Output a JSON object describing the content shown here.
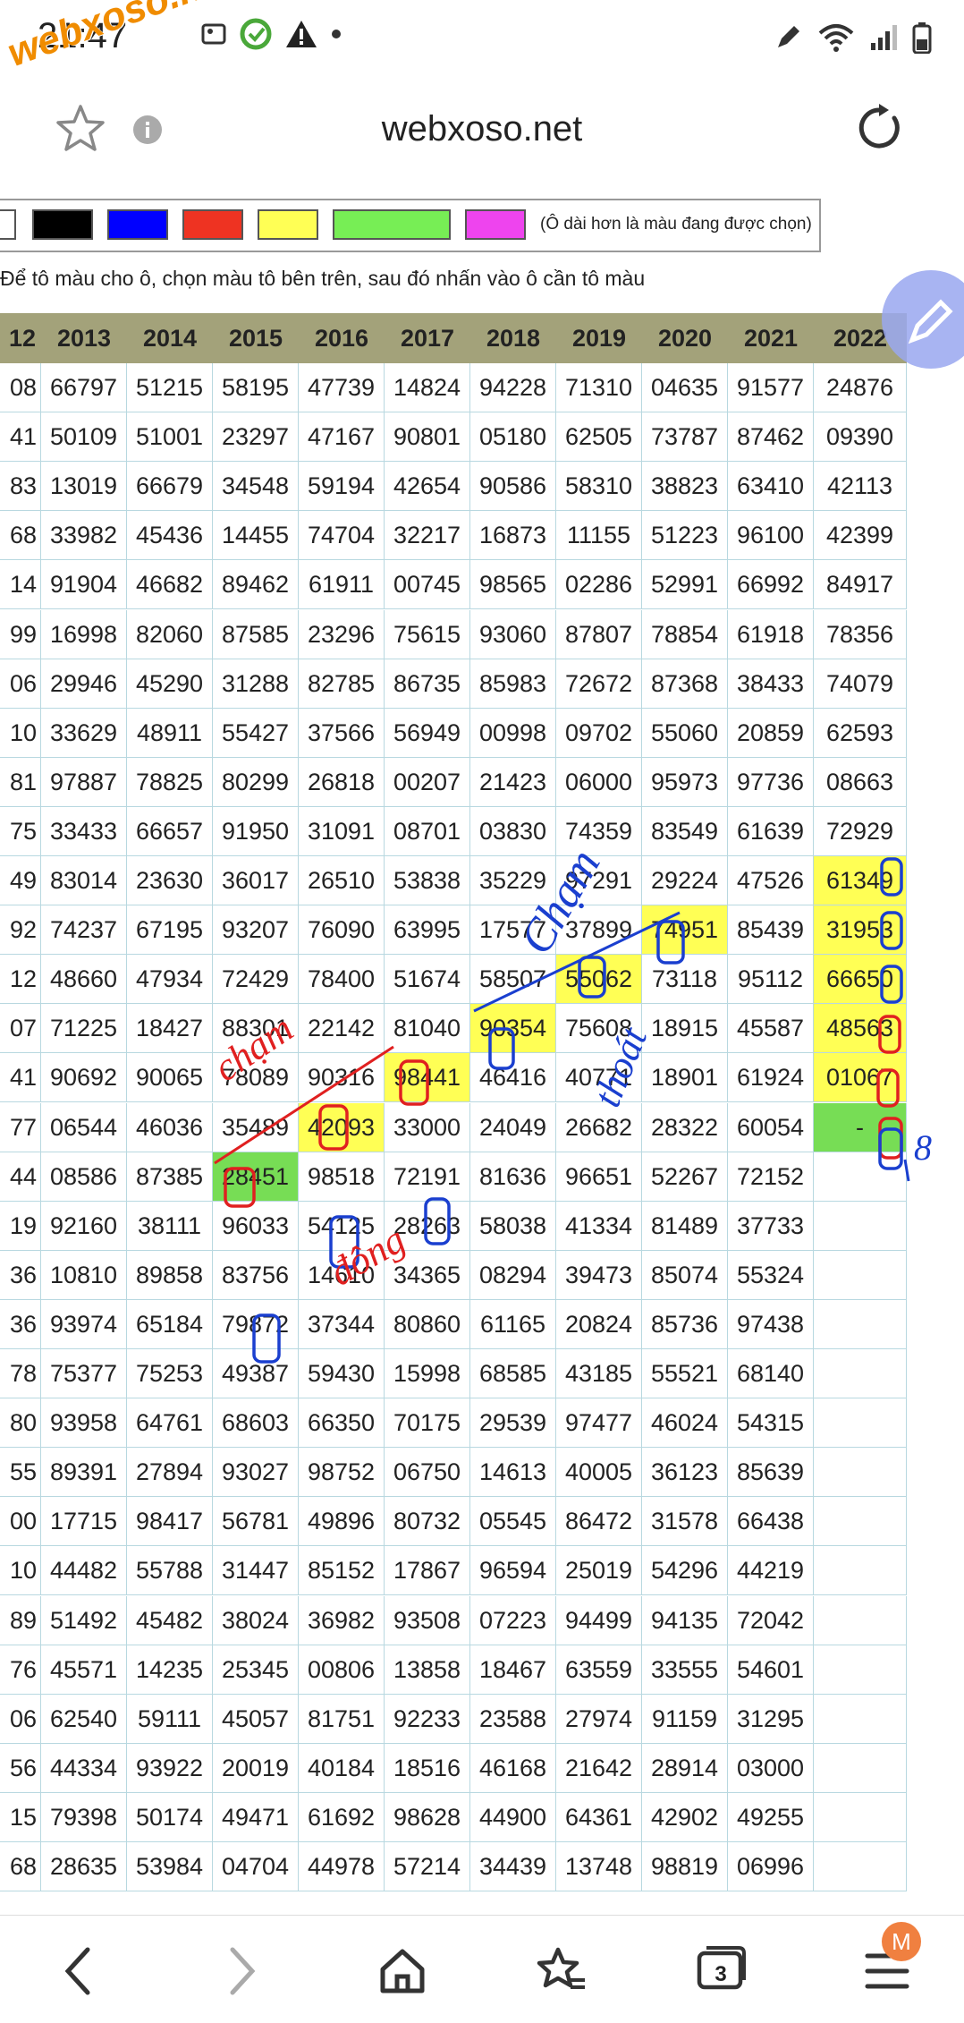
{
  "status": {
    "time": "21:47",
    "watermark": "webxoso.net"
  },
  "browser": {
    "title": "webxoso.net",
    "tab_count": "3",
    "profile_initial": "M"
  },
  "palette": {
    "colors": [
      "#ffffff",
      "#000000",
      "#0000ff",
      "#ee3322",
      "#ffff55",
      "#77ee55",
      "#ee44ee"
    ],
    "note": "(Ô dài hơn là màu đang được chọn)"
  },
  "instruction": "Để tô màu cho ô, chọn màu tô bên trên, sau đó nhấn vào ô cần tô màu",
  "table": {
    "headers": [
      "12",
      "2013",
      "2014",
      "2015",
      "2016",
      "2017",
      "2018",
      "2019",
      "2020",
      "2021",
      "2022"
    ],
    "rows": [
      [
        "08",
        "66797",
        "51215",
        "58195",
        "47739",
        "14824",
        "94228",
        "71310",
        "04635",
        "91577",
        "24876"
      ],
      [
        "41",
        "50109",
        "51001",
        "23297",
        "47167",
        "90801",
        "05180",
        "62505",
        "73787",
        "87462",
        "09390"
      ],
      [
        "83",
        "13019",
        "66679",
        "34548",
        "59194",
        "42654",
        "90586",
        "58310",
        "38823",
        "63410",
        "42113"
      ],
      [
        "68",
        "33982",
        "45436",
        "14455",
        "74704",
        "32217",
        "16873",
        "11155",
        "51223",
        "96100",
        "42399"
      ],
      [
        "14",
        "91904",
        "46682",
        "89462",
        "61911",
        "00745",
        "98565",
        "02286",
        "52991",
        "66992",
        "84917"
      ],
      [
        "99",
        "16998",
        "82060",
        "87585",
        "23296",
        "75615",
        "93060",
        "87807",
        "78854",
        "61918",
        "78356"
      ],
      [
        "06",
        "29946",
        "45290",
        "31288",
        "82785",
        "86735",
        "85983",
        "72672",
        "87368",
        "38433",
        "74079"
      ],
      [
        "10",
        "33629",
        "48911",
        "55427",
        "37566",
        "56949",
        "00998",
        "09702",
        "55060",
        "20859",
        "62593"
      ],
      [
        "81",
        "97887",
        "78825",
        "80299",
        "26818",
        "00207",
        "21423",
        "06000",
        "95973",
        "97736",
        "08663"
      ],
      [
        "75",
        "33433",
        "66657",
        "91950",
        "31091",
        "08701",
        "03830",
        "74359",
        "83549",
        "61639",
        "72929"
      ],
      [
        "49",
        "83014",
        "23630",
        "36017",
        "26510",
        "53838",
        "35229",
        "97291",
        "29224",
        "47526",
        "61349"
      ],
      [
        "92",
        "74237",
        "67195",
        "93207",
        "76090",
        "63995",
        "17577",
        "37899",
        "74951",
        "85439",
        "31953"
      ],
      [
        "12",
        "48660",
        "47934",
        "72429",
        "78400",
        "51674",
        "58507",
        "55062",
        "73118",
        "95112",
        "66650"
      ],
      [
        "07",
        "71225",
        "18427",
        "88301",
        "22142",
        "81040",
        "90354",
        "75608",
        "18915",
        "45587",
        "48563"
      ],
      [
        "41",
        "90692",
        "90065",
        "78089",
        "90316",
        "98441",
        "46416",
        "40771",
        "18901",
        "61924",
        "01067"
      ],
      [
        "77",
        "06544",
        "46036",
        "35489",
        "42093",
        "33000",
        "24049",
        "26682",
        "28322",
        "60054",
        "-"
      ],
      [
        "44",
        "08586",
        "87385",
        "28451",
        "98518",
        "72191",
        "81636",
        "96651",
        "52267",
        "72152",
        ""
      ],
      [
        "19",
        "92160",
        "38111",
        "96033",
        "54125",
        "28263",
        "58038",
        "41334",
        "81489",
        "37733",
        ""
      ],
      [
        "36",
        "10810",
        "89858",
        "83756",
        "14610",
        "34365",
        "08294",
        "39473",
        "85074",
        "55324",
        ""
      ],
      [
        "36",
        "93974",
        "65184",
        "79872",
        "37344",
        "80860",
        "61165",
        "20824",
        "85736",
        "97438",
        ""
      ],
      [
        "78",
        "75377",
        "75253",
        "49387",
        "59430",
        "15998",
        "68585",
        "43185",
        "55521",
        "68140",
        ""
      ],
      [
        "80",
        "93958",
        "64761",
        "68603",
        "66350",
        "70175",
        "29539",
        "97477",
        "46024",
        "54315",
        ""
      ],
      [
        "55",
        "89391",
        "27894",
        "93027",
        "98752",
        "06750",
        "14613",
        "40005",
        "36123",
        "85639",
        ""
      ],
      [
        "00",
        "17715",
        "98417",
        "56781",
        "49896",
        "80732",
        "05545",
        "86472",
        "31578",
        "66438",
        ""
      ],
      [
        "10",
        "44482",
        "55788",
        "31447",
        "85152",
        "17867",
        "96594",
        "25019",
        "54296",
        "44219",
        ""
      ],
      [
        "89",
        "51492",
        "45482",
        "38024",
        "36982",
        "93508",
        "07223",
        "94499",
        "94135",
        "72042",
        ""
      ],
      [
        "76",
        "45571",
        "14235",
        "25345",
        "00806",
        "13858",
        "18467",
        "63559",
        "33555",
        "54601",
        ""
      ],
      [
        "06",
        "62540",
        "59111",
        "45057",
        "81751",
        "92233",
        "23588",
        "27974",
        "91159",
        "31295",
        ""
      ],
      [
        "56",
        "44334",
        "93922",
        "20019",
        "40184",
        "18516",
        "46168",
        "21642",
        "28914",
        "03000",
        ""
      ],
      [
        "15",
        "79398",
        "50174",
        "49471",
        "61692",
        "98628",
        "44900",
        "64361",
        "42902",
        "49255",
        ""
      ],
      [
        "68",
        "28635",
        "53984",
        "04704",
        "44978",
        "57214",
        "34439",
        "13748",
        "98819",
        "06996",
        ""
      ]
    ],
    "highlights": [
      {
        "row": 10,
        "col": 10,
        "color": "yellow"
      },
      {
        "row": 11,
        "col": 10,
        "color": "yellow"
      },
      {
        "row": 12,
        "col": 10,
        "color": "yellow"
      },
      {
        "row": 13,
        "col": 10,
        "color": "yellow"
      },
      {
        "row": 14,
        "col": 10,
        "color": "yellow"
      },
      {
        "row": 15,
        "col": 10,
        "color": "green"
      },
      {
        "row": 11,
        "col": 8,
        "color": "yellow"
      },
      {
        "row": 12,
        "col": 7,
        "color": "yellow"
      },
      {
        "row": 13,
        "col": 6,
        "color": "yellow"
      },
      {
        "row": 14,
        "col": 5,
        "color": "yellow"
      },
      {
        "row": 15,
        "col": 4,
        "color": "yellow"
      },
      {
        "row": 16,
        "col": 3,
        "color": "green"
      }
    ]
  },
  "annotations": {
    "cham_red": "chạm",
    "cham_blue": "Chạm",
    "thoat": "thoát",
    "dong": "đông",
    "extra": "8"
  }
}
